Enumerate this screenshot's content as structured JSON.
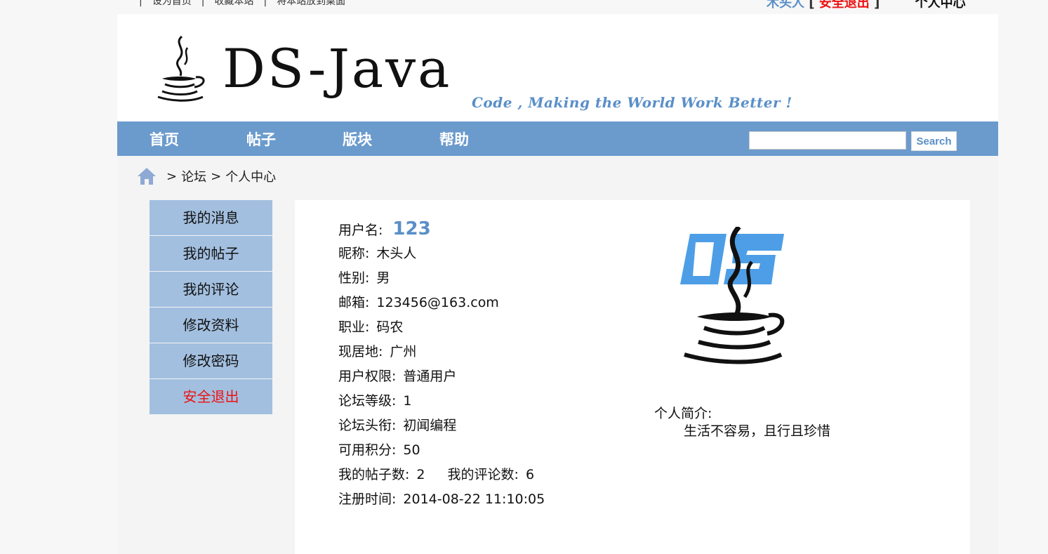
{
  "top": {
    "links": [
      "设为首页",
      "收藏本站",
      "将本站放到桌面"
    ],
    "user": "木头人",
    "bracket_open": "[",
    "logout": "安全退出",
    "bracket_close": "]",
    "center": "个人中心"
  },
  "header": {
    "logo_text": "DS-Java",
    "slogan": "Code , Making the World Work Better !"
  },
  "nav": {
    "items": [
      "首页",
      "帖子",
      "版块",
      "帮助"
    ],
    "search_value": "",
    "search_button": "Search"
  },
  "breadcrumb": {
    "sep": ">",
    "items": [
      "论坛",
      "个人中心"
    ]
  },
  "side_menu": [
    "我的消息",
    "我的帖子",
    "我的评论",
    "修改资料",
    "修改密码",
    "安全退出"
  ],
  "profile": {
    "username_label": "用户名:",
    "username": "123",
    "nickname_label": "昵称:",
    "nickname": "木头人",
    "gender_label": "性别:",
    "gender": "男",
    "email_label": "邮箱:",
    "email": "123456@163.com",
    "job_label": "职业:",
    "job": "码农",
    "city_label": "现居地:",
    "city": "广州",
    "role_label": "用户权限:",
    "role": "普通用户",
    "level_label": "论坛等级:",
    "level": "1",
    "title_label": "论坛头衔:",
    "title": "初闻编程",
    "points_label": "可用积分:",
    "points": "50",
    "posts_label": "我的帖子数:",
    "posts": "2",
    "comments_label": "我的评论数:",
    "comments": "6",
    "registered_label": "注册时间:",
    "registered": "2014-08-22 11:10:05",
    "bio_label": "个人简介:",
    "bio": "生活不容易，且行且珍惜"
  },
  "colors": {
    "nav": "#6b9bcd",
    "side": "#a2bfdf",
    "accent": "#5a8fc8",
    "danger": "#e11111"
  }
}
